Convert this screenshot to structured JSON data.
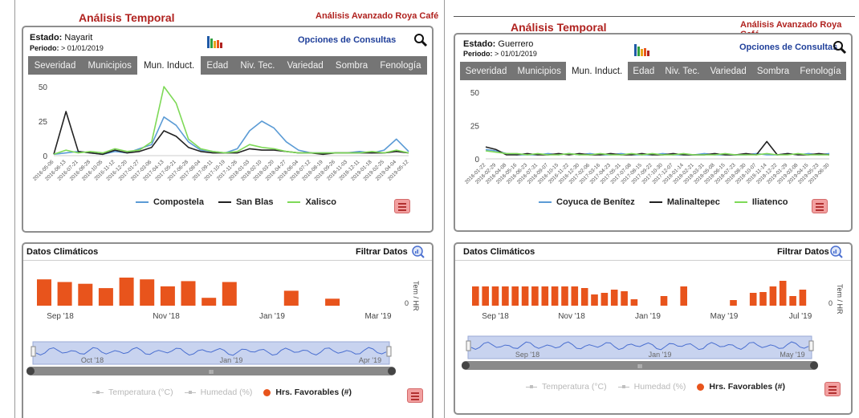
{
  "colors": {
    "title": "#b0221f",
    "tab_bg": "#757575",
    "bar": "#e8541c",
    "navigator_fill": "#c8d3ef",
    "navigator_line": "#4a6fd0",
    "menu_bg": "#f2a0a0"
  },
  "left": {
    "app_title": "Análisis Temporal",
    "brand": "Análisis Avanzado Roya Café",
    "estado_label": "Estado:",
    "estado_value": "Nayarit",
    "periodo_label": "Periodo:",
    "periodo_value": "> 01/01/2019",
    "opciones": "Opciones de Consultas",
    "tabs": [
      "Severidad",
      "Municipios",
      "Mun. Induct.",
      "Edad",
      "Niv. Tec.",
      "Variedad",
      "Sombra",
      "Fenología"
    ],
    "active_tab": 2,
    "chart_data": {
      "type": "line",
      "yticks": [
        "50",
        "25",
        "0"
      ],
      "ylim": [
        0,
        50
      ],
      "x": [
        "2016-05-06",
        "2016-06-13",
        "2016-07-21",
        "2016-08-28",
        "2016-10-05",
        "2016-11-12",
        "2016-12-20",
        "2017-01-27",
        "2017-03-06",
        "2017-04-13",
        "2017-05-21",
        "2017-06-28",
        "2017-08-04",
        "2017-09-11",
        "2017-10-19",
        "2017-11-26",
        "2018-01-03",
        "2018-02-10",
        "2018-03-20",
        "2018-04-27",
        "2018-06-04",
        "2018-07-12",
        "2018-08-19",
        "2018-09-26",
        "2018-11-03",
        "2018-12-11",
        "2019-01-18",
        "2019-02-25",
        "2019-04-04",
        "2019-05-12"
      ],
      "series": [
        {
          "name": "Compostela",
          "color": "#5b9bd5",
          "values": [
            1,
            2,
            3,
            2,
            1,
            3,
            2,
            5,
            8,
            28,
            22,
            10,
            4,
            3,
            2,
            5,
            18,
            25,
            20,
            10,
            4,
            2,
            2,
            2,
            2,
            3,
            2,
            4,
            12,
            3
          ]
        },
        {
          "name": "San Blas",
          "color": "#222222",
          "values": [
            1,
            32,
            3,
            2,
            1,
            4,
            2,
            3,
            6,
            18,
            14,
            6,
            3,
            2,
            2,
            2,
            5,
            4,
            4,
            3,
            2,
            2,
            1,
            2,
            2,
            2,
            2,
            2,
            3,
            2
          ]
        },
        {
          "name": "Xalisco",
          "color": "#7ed957",
          "values": [
            1,
            4,
            2,
            3,
            2,
            5,
            3,
            4,
            10,
            50,
            38,
            12,
            5,
            3,
            2,
            3,
            8,
            6,
            5,
            3,
            2,
            2,
            2,
            2,
            2,
            2,
            3,
            2,
            4,
            2
          ]
        }
      ]
    },
    "climate": {
      "header": "Datos Climáticos",
      "filtrar": "Filtrar Datos",
      "y_axis_label": "Tem / HR",
      "y_zero": "0",
      "xticks": [
        "Sep '18",
        "Nov '18",
        "Jan '19",
        "Mar '19"
      ],
      "navigator_ticks": [
        "Oct '18",
        "Jan '19",
        "Apr '19"
      ],
      "scrollbar_grip": "III",
      "legend": {
        "temperatura": "Temperatura (°C)",
        "humedad": "Humedad (%)",
        "horas": "Hrs. Favorables (#)"
      },
      "chart_data": {
        "type": "bar",
        "series": [
          {
            "name": "Hrs. Favorables (#)",
            "values": [
              30,
              27,
              25,
              20,
              32,
              30,
              22,
              28,
              9,
              27,
              0,
              0,
              17,
              0,
              8,
              0,
              0
            ]
          }
        ]
      }
    }
  },
  "right": {
    "app_title": "Análisis Temporal",
    "brand": "Análisis Avanzado Roya Café",
    "estado_label": "Estado:",
    "estado_value": "Guerrero",
    "periodo_label": "Periodo:",
    "periodo_value": "> 01/01/2019",
    "opciones": "Opciones de Consultas",
    "tabs": [
      "Severidad",
      "Municipios",
      "Mun. Induct.",
      "Edad",
      "Niv. Tec.",
      "Variedad",
      "Sombra",
      "Fenología"
    ],
    "active_tab": 2,
    "chart_data": {
      "type": "line",
      "yticks": [
        "50",
        "25",
        "0"
      ],
      "ylim": [
        0,
        50
      ],
      "x": [
        "2016-01-22",
        "2016-02-29",
        "2016-04-08",
        "2016-05-16",
        "2016-06-23",
        "2016-07-31",
        "2016-09-07",
        "2016-10-15",
        "2016-11-22",
        "2016-12-30",
        "2017-02-06",
        "2017-03-16",
        "2017-04-23",
        "2017-05-31",
        "2017-07-08",
        "2017-08-15",
        "2017-09-22",
        "2017-10-30",
        "2017-12-07",
        "2018-01-14",
        "2018-02-21",
        "2018-03-31",
        "2018-05-08",
        "2018-06-15",
        "2018-07-23",
        "2018-08-30",
        "2018-10-07",
        "2018-11-14",
        "2018-12-22",
        "2019-01-29",
        "2019-03-08",
        "2019-04-15",
        "2019-05-23",
        "2019-06-30"
      ],
      "series": [
        {
          "name": "Coyuca de Benítez",
          "color": "#5b9bd5",
          "values": [
            7,
            6,
            4,
            3,
            3,
            3,
            4,
            3,
            4,
            3,
            4,
            3,
            3,
            4,
            3,
            3,
            3,
            4,
            3,
            3,
            3,
            4,
            3,
            3,
            3,
            3,
            4,
            3,
            3,
            4,
            3,
            4,
            3,
            4
          ]
        },
        {
          "name": "Malinaltepec",
          "color": "#222222",
          "values": [
            9,
            7,
            3,
            3,
            4,
            3,
            3,
            4,
            3,
            4,
            3,
            3,
            4,
            3,
            3,
            4,
            3,
            3,
            4,
            3,
            3,
            3,
            4,
            3,
            3,
            4,
            3,
            13,
            3,
            4,
            3,
            3,
            4,
            3
          ]
        },
        {
          "name": "Iliatenco",
          "color": "#7ed957",
          "values": [
            6,
            5,
            4,
            4,
            3,
            4,
            3,
            3,
            4,
            3,
            3,
            4,
            3,
            3,
            4,
            3,
            4,
            3,
            3,
            4,
            3,
            3,
            3,
            4,
            3,
            3,
            3,
            4,
            3,
            3,
            4,
            3,
            3,
            3
          ]
        }
      ]
    },
    "climate": {
      "header": "Datos Climáticos",
      "filtrar": "Filtrar Datos",
      "y_axis_label": "Tem / HR",
      "y_zero": "0",
      "xticks": [
        "Sep '18",
        "Nov '18",
        "Jan '19",
        "May '19",
        "Jul '19"
      ],
      "navigator_ticks": [
        "Sep '18",
        "Jan '19",
        "May '19"
      ],
      "scrollbar_grip": "III",
      "legend": {
        "temperatura": "Temperatura (°C)",
        "humedad": "Humedad (%)",
        "horas": "Hrs. Favorables (#)"
      },
      "chart_data": {
        "type": "bar",
        "series": [
          {
            "name": "Hrs. Favorables (#)",
            "values": [
              24,
              24,
              24,
              24,
              24,
              24,
              24,
              24,
              24,
              24,
              24,
              22,
              14,
              16,
              20,
              18,
              8,
              0,
              0,
              12,
              0,
              24,
              0,
              0,
              0,
              0,
              7,
              0,
              16,
              17,
              24,
              31,
              12,
              20
            ]
          }
        ]
      }
    }
  }
}
